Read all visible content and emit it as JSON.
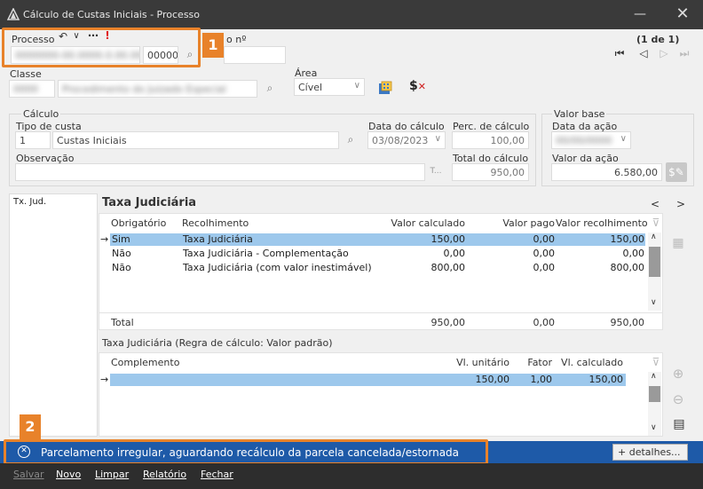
{
  "window": {
    "title": "Cálculo de Custas Iniciais - Processo"
  },
  "annotations": {
    "badge1": "1",
    "badge2": "2"
  },
  "processo": {
    "label": "Processo",
    "number_blurred": "0000000-00.0000.0.00.0000",
    "code": "00000",
    "calc_no_label": "o nº"
  },
  "pager": {
    "text": "(1 de 1)"
  },
  "classe": {
    "label": "Classe",
    "code_blurred": "0000",
    "desc_blurred": "Procedimento do Juizado Especial"
  },
  "area": {
    "label": "Área",
    "value": "Cível"
  },
  "calculo": {
    "group_label": "Cálculo",
    "tipo_label": "Tipo de custa",
    "tipo_code": "1",
    "tipo_desc": "Custas Iniciais",
    "data_label": "Data do cálculo",
    "data_value": "03/08/2023",
    "perc_label": "Perc. de cálculo",
    "perc_value": "100,00",
    "obs_label": "Observação",
    "obs_btn": "T...",
    "total_label": "Total do cálculo",
    "total_value": "950,00"
  },
  "valor_base": {
    "group_label": "Valor base",
    "data_acao_label": "Data da ação",
    "data_acao_blurred": "00/00/0000",
    "valor_acao_label": "Valor da ação",
    "valor_acao_value": "6.580,00"
  },
  "left_list": {
    "items": [
      "Tx. Jud."
    ]
  },
  "taxa": {
    "title": "Taxa Judiciária",
    "nav_prev": "<",
    "nav_next": ">",
    "columns": [
      "Obrigatório",
      "Recolhimento",
      "Valor calculado",
      "Valor pago",
      "Valor recolhimento"
    ],
    "rows": [
      {
        "obrigatorio": "Sim",
        "recolhimento": "Taxa Judiciária",
        "calculado": "150,00",
        "pago": "0,00",
        "valor": "150,00"
      },
      {
        "obrigatorio": "Não",
        "recolhimento": "Taxa Judiciária - Complementação",
        "calculado": "0,00",
        "pago": "0,00",
        "valor": "0,00"
      },
      {
        "obrigatorio": "Não",
        "recolhimento": "Taxa Judiciária (com valor inestimável)",
        "calculado": "800,00",
        "pago": "0,00",
        "valor": "800,00"
      }
    ],
    "total_label": "Total",
    "total_calculado": "950,00",
    "total_pago": "0,00",
    "total_valor": "950,00"
  },
  "regra": {
    "title": "Taxa Judiciária (Regra de cálculo: Valor padrão)",
    "columns": [
      "Complemento",
      "Vl. unitário",
      "Fator",
      "Vl. calculado"
    ],
    "rows": [
      {
        "complemento": "",
        "unitario": "150,00",
        "fator": "1,00",
        "calculado": "150,00"
      }
    ]
  },
  "status": {
    "message": "Parcelamento irregular, aguardando recálculo da parcela cancelada/estornada",
    "details_label": "+ detalhes..."
  },
  "toolbar": {
    "salvar": "Salvar",
    "novo": "Novo",
    "limpar": "Limpar",
    "relatorio": "Relatório",
    "fechar": "Fechar"
  },
  "colors": {
    "accent_orange": "#e8822a",
    "status_blue": "#1e5aa8",
    "selected_row": "#9dc8ec"
  }
}
